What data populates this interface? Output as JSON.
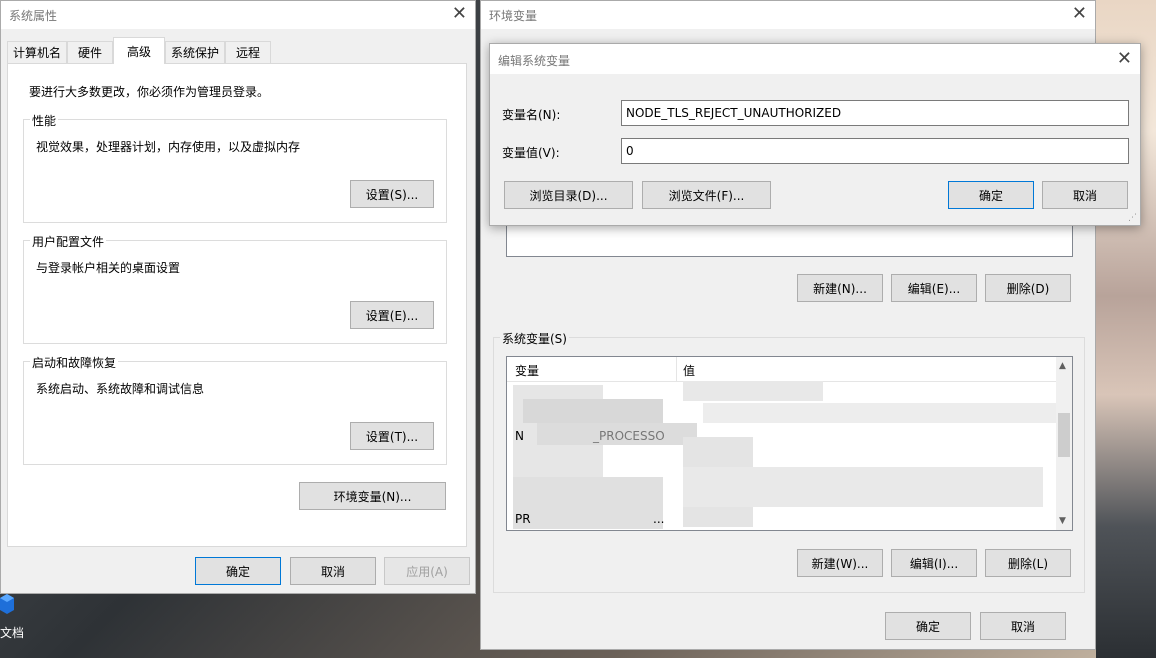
{
  "desktop": {
    "icon_label": "文档"
  },
  "sysprops": {
    "title": "系统属性",
    "tabs": [
      {
        "label": "计算机名"
      },
      {
        "label": "硬件"
      },
      {
        "label": "高级"
      },
      {
        "label": "系统保护"
      },
      {
        "label": "远程"
      }
    ],
    "admin_note": "要进行大多数更改，你必须作为管理员登录。",
    "performance": {
      "legend": "性能",
      "desc": "视觉效果，处理器计划，内存使用，以及虚拟内存",
      "button": "设置(S)..."
    },
    "profile": {
      "legend": "用户配置文件",
      "desc": "与登录帐户相关的桌面设置",
      "button": "设置(E)..."
    },
    "startup": {
      "legend": "启动和故障恢复",
      "desc": "系统启动、系统故障和调试信息",
      "button": "设置(T)..."
    },
    "env_button": "环境变量(N)...",
    "ok": "确定",
    "cancel": "取消",
    "apply": "应用(A)"
  },
  "envvars": {
    "title": "环境变量",
    "user_buttons": {
      "new": "新建(N)...",
      "edit": "编辑(E)...",
      "delete": "删除(D)"
    },
    "system_legend": "系统变量(S)",
    "columns": {
      "name": "变量",
      "value": "值"
    },
    "visible_fragments": [
      "N",
      "PR",
      "_PROCESSO",
      "..."
    ],
    "system_buttons": {
      "new": "新建(W)...",
      "edit": "编辑(I)...",
      "delete": "删除(L)"
    },
    "ok": "确定",
    "cancel": "取消"
  },
  "editvar": {
    "title": "编辑系统变量",
    "name_label": "变量名(N):",
    "name_value": "NODE_TLS_REJECT_UNAUTHORIZED",
    "value_label": "变量值(V):",
    "value_value": "0",
    "browse_dir": "浏览目录(D)...",
    "browse_file": "浏览文件(F)...",
    "ok": "确定",
    "cancel": "取消"
  }
}
